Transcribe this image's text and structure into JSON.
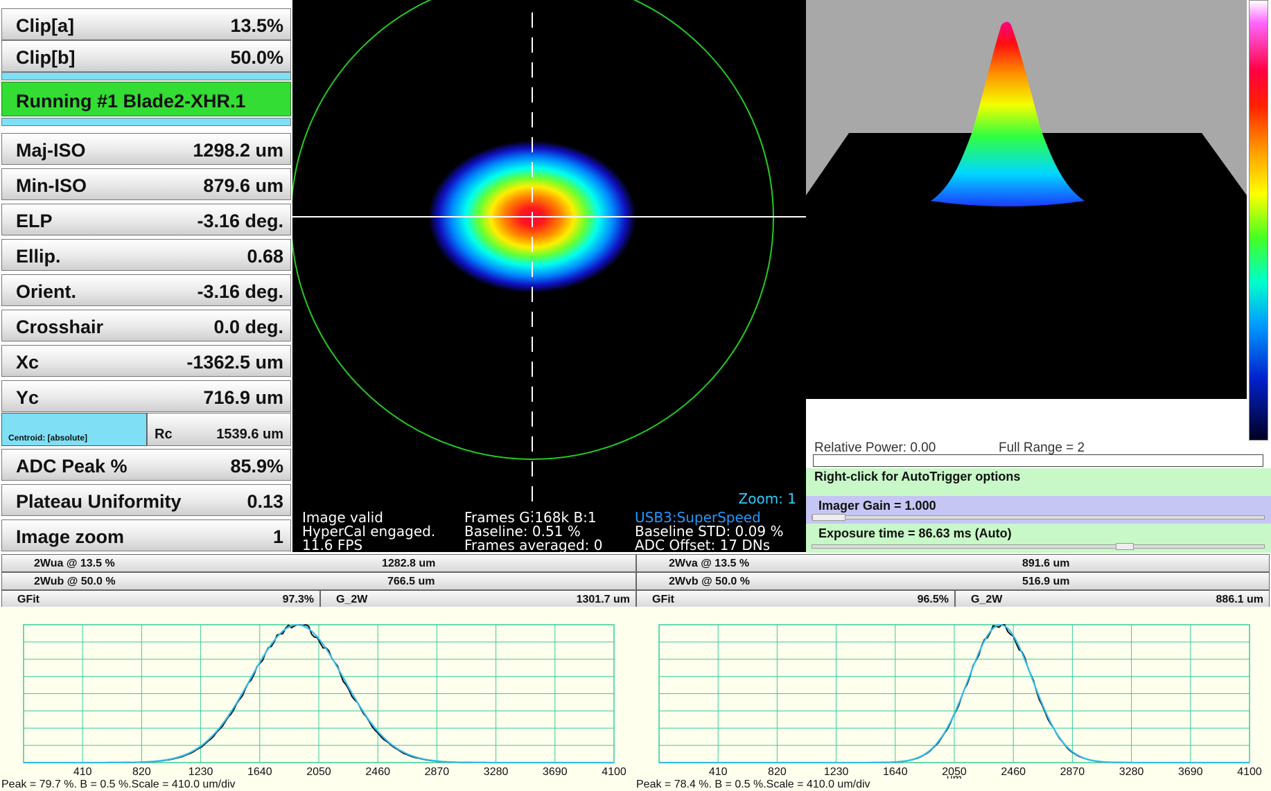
{
  "metrics": {
    "clip_a": {
      "label": "Clip[a]",
      "value": "13.5%"
    },
    "clip_b": {
      "label": "Clip[b]",
      "value": "50.0%"
    },
    "status": "Running #1 Blade2-XHR.1",
    "maj_iso": {
      "label": "Maj-ISO",
      "value": "1298.2 um"
    },
    "min_iso": {
      "label": "Min-ISO",
      "value": "879.6 um"
    },
    "elp": {
      "label": "ELP",
      "value": "-3.16 deg."
    },
    "ellip": {
      "label": "Ellip.",
      "value": "0.68"
    },
    "orient": {
      "label": "Orient.",
      "value": "-3.16 deg."
    },
    "crosshair": {
      "label": "Crosshair",
      "value": "0.0 deg."
    },
    "xc": {
      "label": "Xc",
      "value": "-1362.5 um"
    },
    "yc": {
      "label": "Yc",
      "value": "716.9 um"
    },
    "centroid_mode": "Centroid: [absolute]",
    "rc": {
      "label": "Rc",
      "value": "1539.6 um"
    },
    "adc_peak": {
      "label": "ADC Peak %",
      "value": "85.9%"
    },
    "plateau": {
      "label": "Plateau Uniformity",
      "value": "0.13"
    },
    "image_zoom": {
      "label": "Image zoom",
      "value": "1"
    }
  },
  "beam_view": {
    "zoom": "Zoom: 1",
    "image_valid": "Image valid",
    "hypercal": "HyperCal engaged.",
    "fps": "11.6 FPS",
    "frames": "Frames G:168k B:1",
    "baseline": "Baseline: 0.51 %",
    "frames_averaged": "Frames averaged: 0",
    "usb": "USB3:SuperSpeed",
    "baseline_std": "Baseline STD:  0.09 %",
    "adc_offset": "ADC Offset: 17 DNs"
  },
  "controls": {
    "relative_power": "Relative Power: 0.00",
    "full_range": "Full Range = 2",
    "autotrigger": "Right-click for AutoTrigger options",
    "imager_gain": "Imager Gain = 1.000",
    "exposure": "Exposure time = 86.63 ms (Auto)"
  },
  "stats": {
    "wua_label": "2Wua @ 13.5 %",
    "wua_value": "1282.8 um",
    "wva_label": "2Wva @ 13.5 %",
    "wva_value": "891.6 um",
    "wub_label": "2Wub @ 50.0 %",
    "wub_value": "766.5 um",
    "wvb_label": "2Wvb @ 50.0 %",
    "wvb_value": "516.9 um",
    "gfit_label": "GFit",
    "gfit_u": "97.3%",
    "g2w_label": "G_2W",
    "g2w_u": "1301.7 um",
    "gfit_v": "96.5%",
    "g2w_v": "886.1 um"
  },
  "chart_data": [
    {
      "type": "line",
      "xlabel": "",
      "x_ticks": [
        "410",
        "820",
        "1230",
        "1640",
        "2050",
        "2460",
        "2870",
        "3280",
        "3690",
        "4100"
      ],
      "xlim": [
        0,
        4100
      ],
      "ylim": [
        0,
        1
      ],
      "series": [
        {
          "values_desc": "measured",
          "center": 1900,
          "sigma": 320
        },
        {
          "values_desc": "fit",
          "center": 1900,
          "sigma": 325
        }
      ],
      "grid": true,
      "footer": "Peak = 79.7 %. B = 0.5 %.Scale = 410.0 um/div"
    },
    {
      "type": "line",
      "xlabel": "um",
      "x_ticks": [
        "410",
        "820",
        "1230",
        "1640",
        "2050",
        "2460",
        "2870",
        "3280",
        "3690",
        "4100"
      ],
      "xlim": [
        0,
        4100
      ],
      "ylim": [
        0,
        1
      ],
      "series": [
        {
          "values_desc": "measured",
          "center": 2370,
          "sigma": 220
        },
        {
          "values_desc": "fit",
          "center": 2370,
          "sigma": 222
        }
      ],
      "grid": true,
      "footer": "Peak = 78.4 %. B = 0.5 %.Scale = 410.0 um/div"
    }
  ]
}
